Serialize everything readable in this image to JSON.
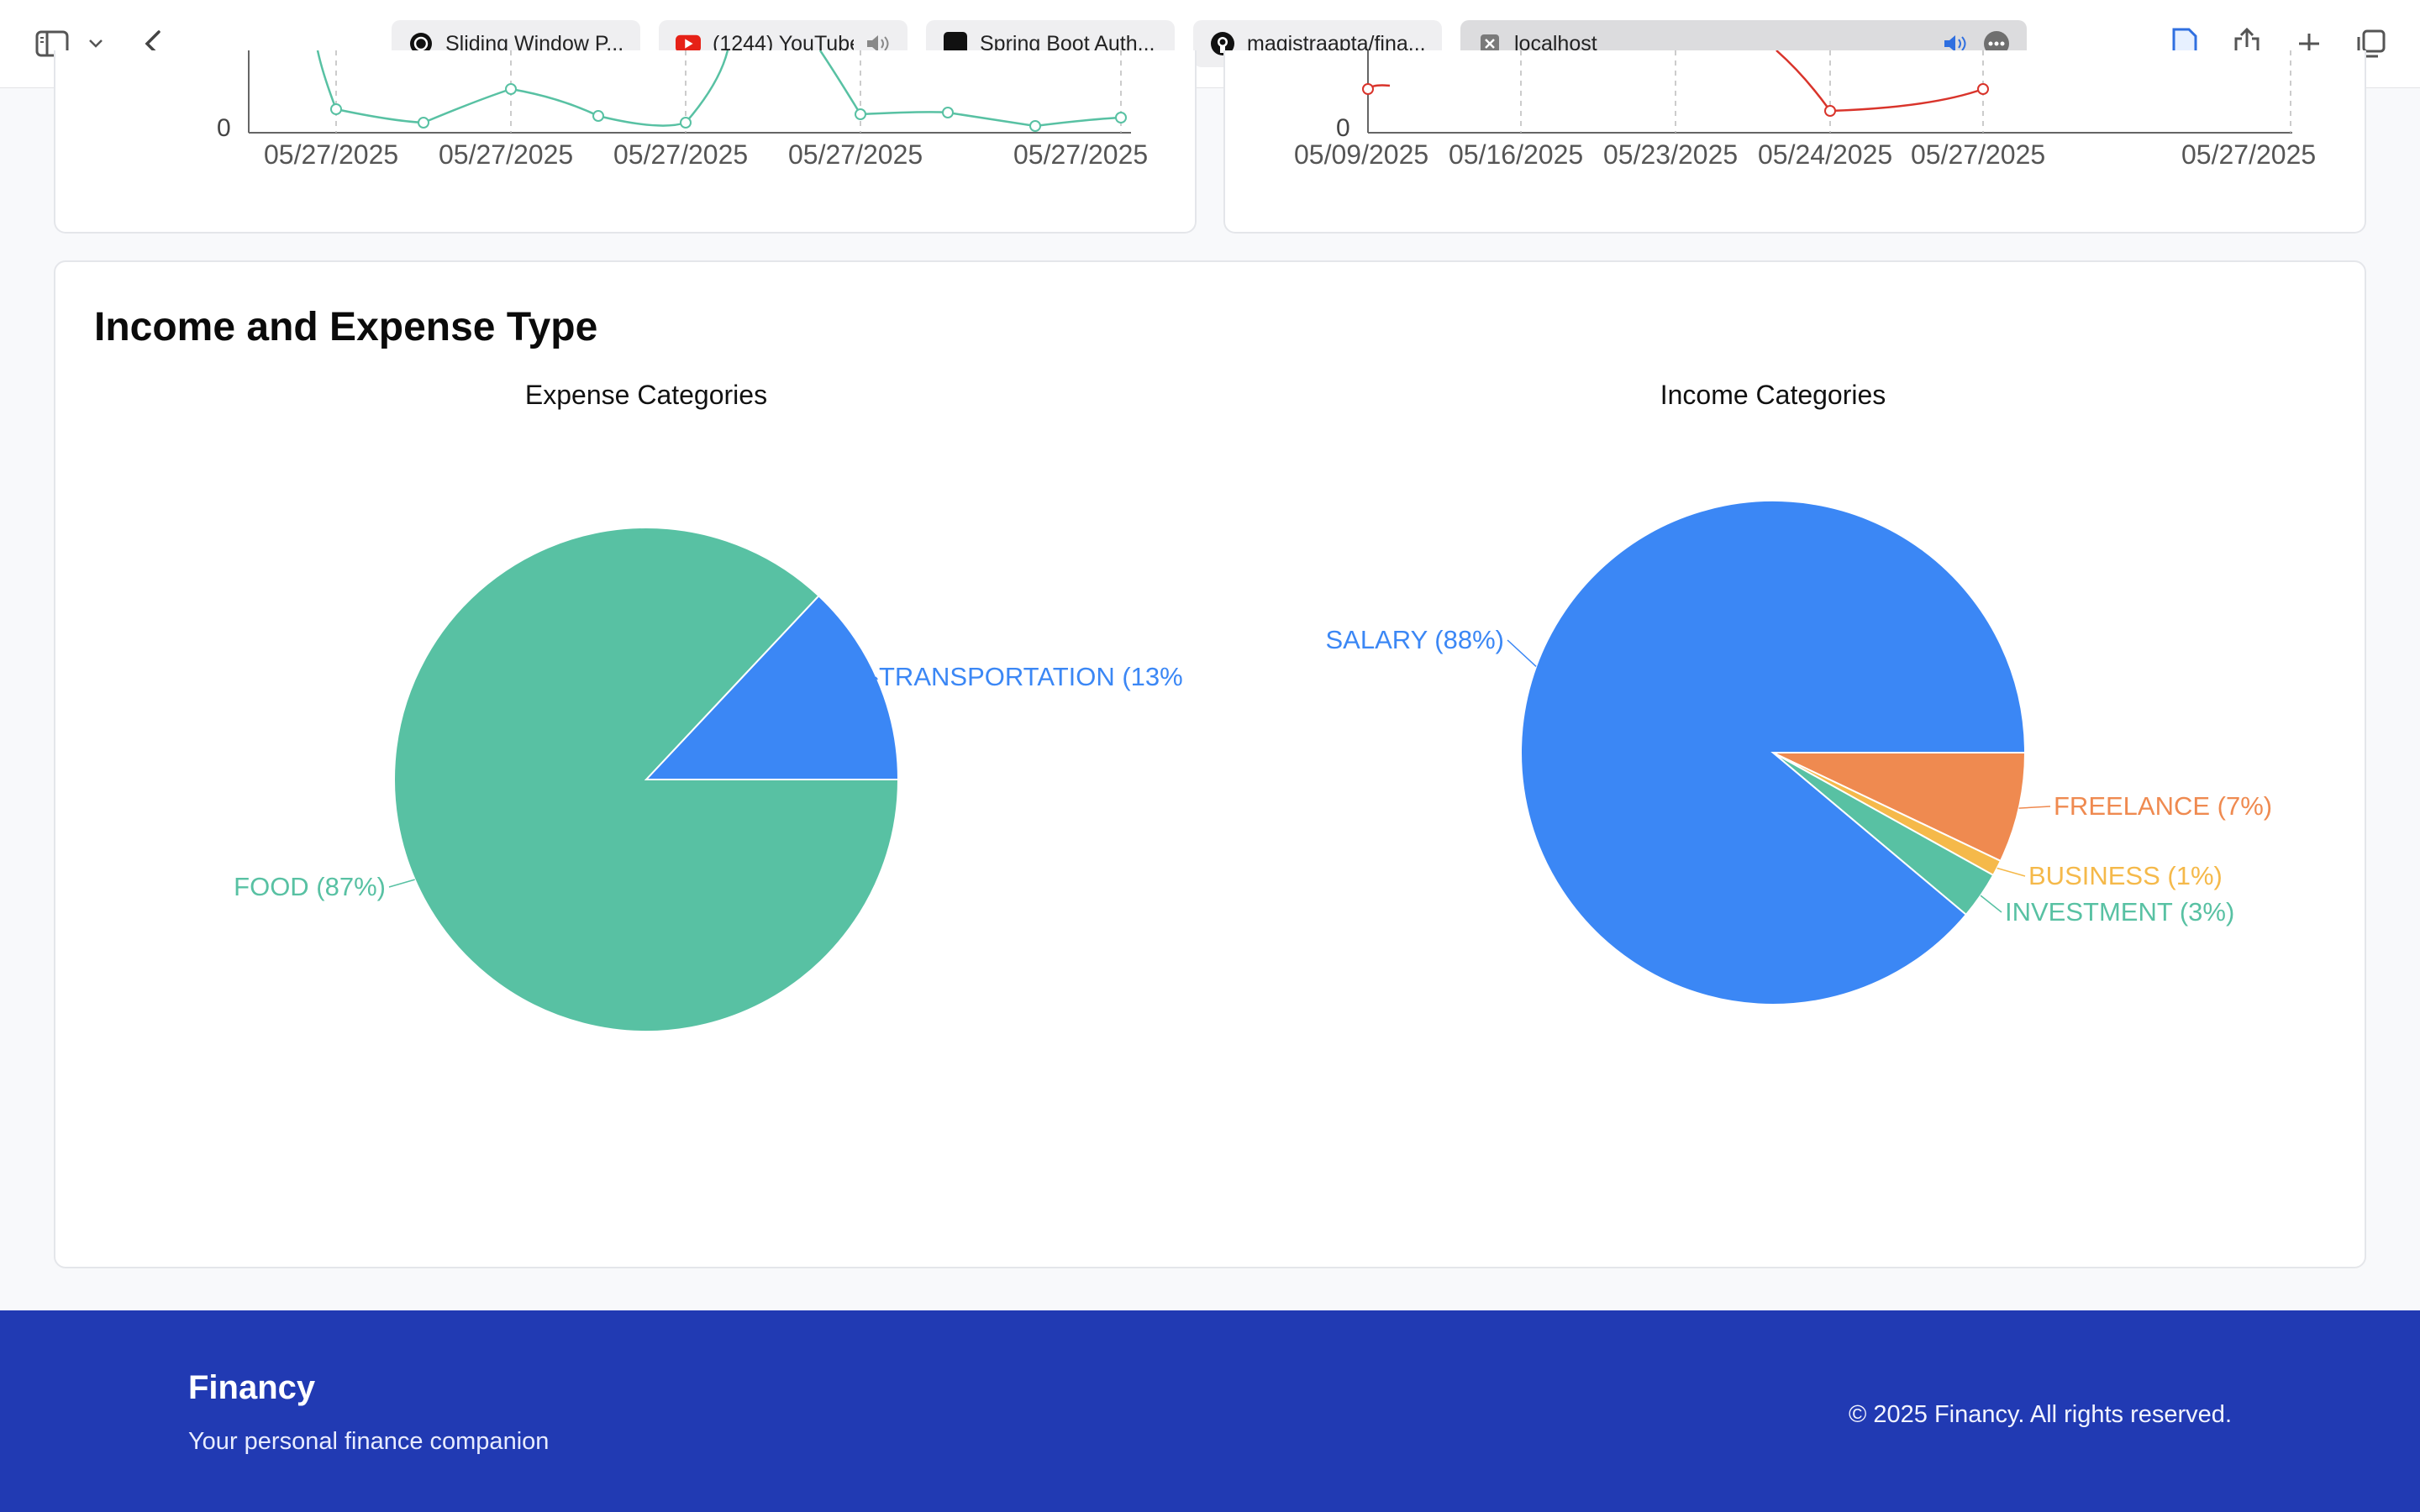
{
  "browser": {
    "tabs": [
      {
        "title": "Sliding Window P...",
        "icon": "chatgpt-icon"
      },
      {
        "title": "(1244) YouTube",
        "icon": "youtube-icon",
        "audio": true
      },
      {
        "title": "Spring Boot Auth...",
        "icon": "square-icon"
      },
      {
        "title": "magistraapta/fina...",
        "icon": "github-icon"
      },
      {
        "title": "localhost",
        "icon": "close-tab-icon",
        "audio": true,
        "active": true
      }
    ]
  },
  "top_charts": {
    "left_axis": {
      "zero_label": "0",
      "dates": [
        "05/27/2025",
        "05/27/2025",
        "05/27/2025",
        "05/27/2025",
        "05/27/2025"
      ]
    },
    "right_axis": {
      "zero_label": "0",
      "dates": [
        "05/09/2025",
        "05/16/2025",
        "05/23/2025",
        "05/24/2025",
        "05/27/2025",
        "05/27/2025"
      ]
    }
  },
  "section": {
    "title": "Income and Expense Type"
  },
  "chart_data": [
    {
      "type": "pie",
      "title": "Expense Categories",
      "slices": [
        {
          "label": "FOOD (87%)",
          "value": 87,
          "color": "#58c1a3"
        },
        {
          "label": "TRANSPORTATION (13%",
          "value": 13,
          "color": "#3b87f5"
        }
      ]
    },
    {
      "type": "pie",
      "title": "Income Categories",
      "slices": [
        {
          "label": "SALARY (88%)",
          "value": 88,
          "color": "#3b87f5"
        },
        {
          "label": "FREELANCE (7%)",
          "value": 7,
          "color": "#ef8a50"
        },
        {
          "label": "BUSINESS (1%)",
          "value": 1,
          "color": "#f5b94a"
        },
        {
          "label": "INVESTMENT (3%)",
          "value": 3,
          "color": "#58c1a3"
        }
      ]
    }
  ],
  "footer": {
    "brand": "Financy",
    "tagline": "Your personal finance companion",
    "copyright": "© 2025 Financy. All rights reserved."
  },
  "colors": {
    "footer_bg": "#213ab3",
    "line_green": "#58c1a3",
    "line_red": "#d9342b"
  }
}
